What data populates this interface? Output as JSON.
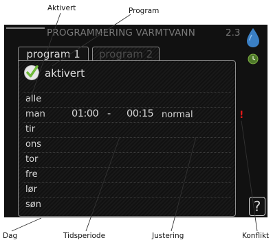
{
  "callouts": {
    "aktivert": "Aktivert",
    "program": "Program",
    "dag": "Dag",
    "tidsperiode": "Tidsperiode",
    "justering": "Justering",
    "konflikt": "Konflikt"
  },
  "screen": {
    "title": "PROGRAMMERING VARMTVANN",
    "menu_number": "2.3",
    "tabs": [
      "program 1",
      "program 2"
    ],
    "active_tab": "program 1",
    "checkbox_label": "aktivert",
    "checkbox_checked": true,
    "days": [
      {
        "day": "alle",
        "start": "",
        "dash": "",
        "end": "",
        "adjust": ""
      },
      {
        "day": "man",
        "start": "01:00",
        "dash": "-",
        "end": "00:15",
        "adjust": "normal"
      },
      {
        "day": "tir",
        "start": "",
        "dash": "",
        "end": "",
        "adjust": ""
      },
      {
        "day": "ons",
        "start": "",
        "dash": "",
        "end": "",
        "adjust": ""
      },
      {
        "day": "tor",
        "start": "",
        "dash": "",
        "end": "",
        "adjust": ""
      },
      {
        "day": "fre",
        "start": "",
        "dash": "",
        "end": "",
        "adjust": ""
      },
      {
        "day": "lør",
        "start": "",
        "dash": "",
        "end": "",
        "adjust": ""
      },
      {
        "day": "søn",
        "start": "",
        "dash": "",
        "end": "",
        "adjust": ""
      }
    ],
    "conflict_marker": "!",
    "help_symbol": "?",
    "icons": [
      "water-drop-icon",
      "clock-icon",
      "help-icon",
      "checkmark-icon"
    ],
    "colors": {
      "background": "#111111",
      "text": "#d8d8d8",
      "conflict": "#e01818",
      "drop": "#3a7fc4",
      "check": "#6fba3a"
    }
  }
}
